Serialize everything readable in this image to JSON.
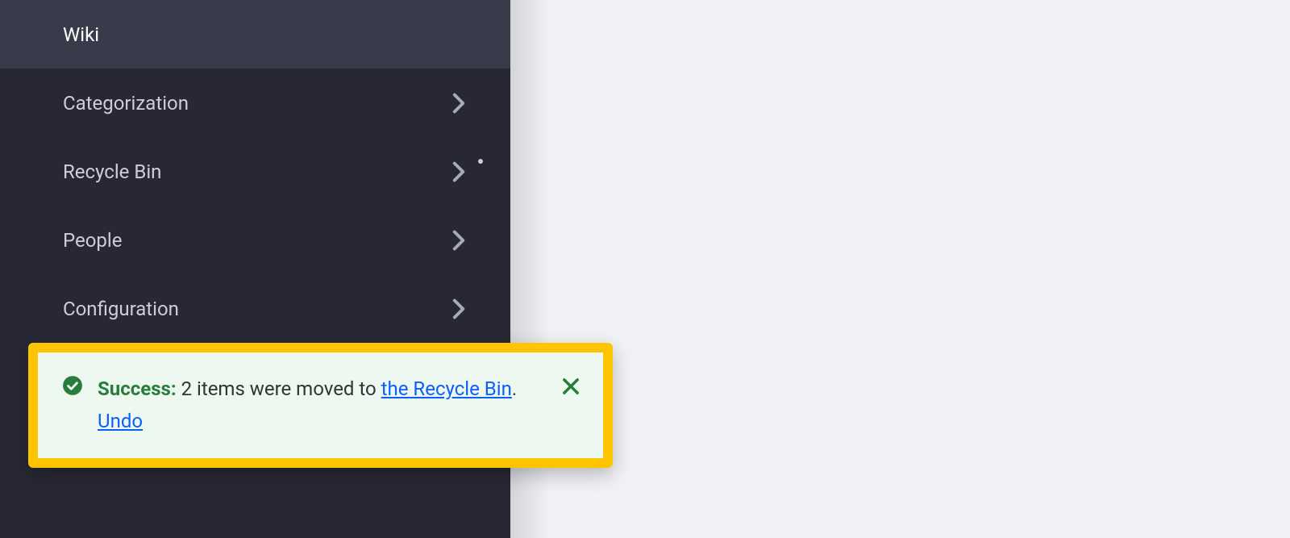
{
  "sidebar": {
    "items": [
      {
        "label": "Wiki",
        "selected": true,
        "hasChevron": false,
        "hasDot": false
      },
      {
        "label": "Categorization",
        "selected": false,
        "hasChevron": true,
        "hasDot": false
      },
      {
        "label": "Recycle Bin",
        "selected": false,
        "hasChevron": true,
        "hasDot": true
      },
      {
        "label": "People",
        "selected": false,
        "hasChevron": true,
        "hasDot": false
      },
      {
        "label": "Configuration",
        "selected": false,
        "hasChevron": true,
        "hasDot": false
      }
    ]
  },
  "toast": {
    "title": "Success:",
    "message_prefix": "2 items were moved to ",
    "recycle_link": "the Recycle Bin",
    "period": ". ",
    "undo_link": "Undo"
  }
}
